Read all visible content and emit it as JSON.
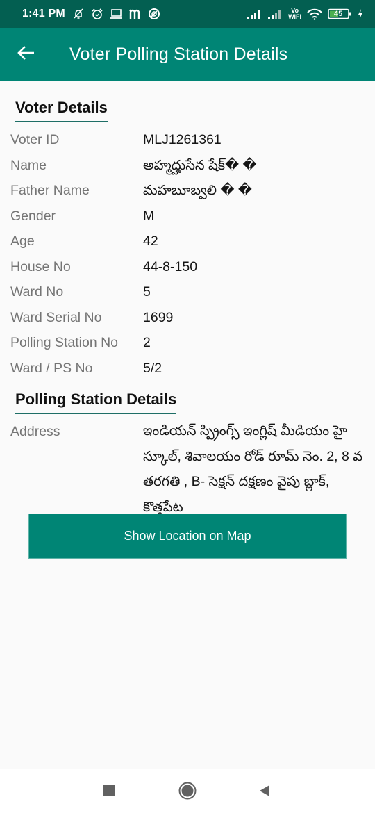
{
  "status_bar": {
    "time": "1:41 PM",
    "left_icons": [
      "notifications-off-icon",
      "alarm-icon",
      "laptop-icon",
      "m-app-icon",
      "circle-app-icon"
    ],
    "right_icons": [
      "signal-1-icon",
      "signal-2-icon",
      "vowifi-icon",
      "wifi-icon",
      "battery-icon",
      "charging-icon"
    ],
    "vowifi_top": "Vo",
    "vowifi_bottom": "WiFi",
    "battery_level": "45",
    "colors": {
      "background": "#035f51",
      "battery_fill": "#4caf50"
    }
  },
  "app_bar": {
    "title": "Voter Polling Station Details",
    "back_icon": "arrow-left-icon",
    "color": "#008575"
  },
  "voter_section": {
    "title": "Voter Details",
    "rows": [
      {
        "label": "Voter ID",
        "value": "MLJ1261361"
      },
      {
        "label": "Name",
        "value": "అహ్మద్హుసేన షేక్� �"
      },
      {
        "label": "Father Name",
        "value": "మహబూబ్వలి � �"
      },
      {
        "label": "Gender",
        "value": "M"
      },
      {
        "label": "Age",
        "value": "42"
      },
      {
        "label": "House No",
        "value": "44-8-150"
      },
      {
        "label": "Ward No",
        "value": "5"
      },
      {
        "label": "Ward Serial No",
        "value": "1699"
      },
      {
        "label": "Polling Station No",
        "value": "2"
      },
      {
        "label": "Ward / PS No",
        "value": "5/2"
      }
    ]
  },
  "polling_section": {
    "title": "Polling Station Details",
    "address_label": "Address",
    "address_value": "ఇండియన్ స్ప్రింగ్స్ ఇంగ్లిష్ మీడియం హై స్కూల్, శివాలయం రోడ్ రూమ్ నెం. 2,  8 వ తరగతి , B- సెక్షన్ దక్షణం వైపు బ్లాక్, కొత్తపేట"
  },
  "map_button": {
    "label": "Show Location on Map"
  },
  "nav_bar": {
    "recents_icon": "square-recents-icon",
    "home_icon": "circle-home-icon",
    "back_icon": "triangle-back-icon"
  }
}
